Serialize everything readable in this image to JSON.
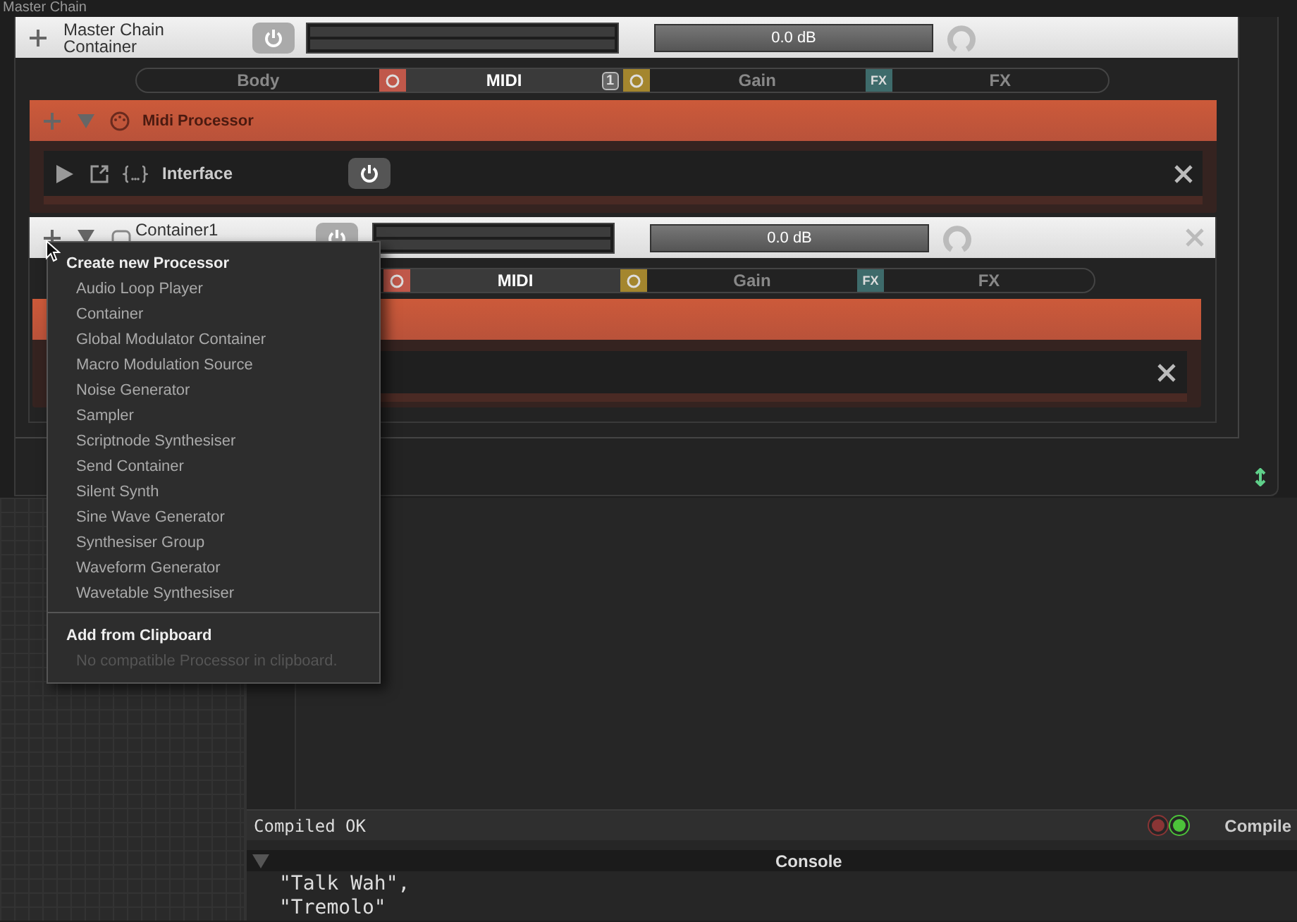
{
  "window": {
    "title": "Master Chain"
  },
  "master": {
    "name": "Master Chain",
    "type": "Container",
    "gain": "0.0 dB",
    "level": 1,
    "tabs": [
      {
        "label": "Body",
        "selected": false
      },
      {
        "label": "MIDI",
        "selected": true,
        "color": "#c0584a",
        "badge": "1"
      },
      {
        "label": "Gain",
        "selected": false,
        "color": "#a4862e"
      },
      {
        "label": "FX",
        "selected": false,
        "color": "#3e6b6b",
        "icon_text": "FX"
      }
    ],
    "children": [
      {
        "kind": "midi",
        "name": "Midi Processor",
        "row": {
          "name": "Interface"
        }
      },
      {
        "kind": "container",
        "name": "Container1",
        "gain": "0.0 dB",
        "level": 1,
        "tabs": [
          {
            "label": "MIDI",
            "selected": true,
            "color": "#c0584a"
          },
          {
            "label": "Gain",
            "selected": false,
            "color": "#a4862e"
          },
          {
            "label": "FX",
            "selected": false,
            "color": "#3e6b6b",
            "icon_text": "FX"
          }
        ]
      }
    ]
  },
  "context_menu": {
    "title": "Create new Processor",
    "items": [
      {
        "label": "Audio Loop Player",
        "disabled": false
      },
      {
        "label": "Container",
        "disabled": false
      },
      {
        "label": "Global Modulator Container",
        "disabled": false
      },
      {
        "label": "Macro Modulation Source",
        "disabled": false
      },
      {
        "label": "Noise Generator",
        "disabled": false
      },
      {
        "label": "Sampler",
        "disabled": false
      },
      {
        "label": "Scriptnode Synthesiser",
        "disabled": false
      },
      {
        "label": "Send Container",
        "disabled": false
      },
      {
        "label": "Silent Synth",
        "disabled": false
      },
      {
        "label": "Sine Wave Generator",
        "disabled": false
      },
      {
        "label": "Synthesiser Group",
        "disabled": false
      },
      {
        "label": "Waveform Generator",
        "disabled": false
      },
      {
        "label": "Wavetable Synthesiser",
        "disabled": false
      }
    ],
    "section": "Add from Clipboard",
    "section_items": [
      {
        "label": "No compatible Processor in clipboard.",
        "disabled": true
      }
    ]
  },
  "compile_bar": {
    "status": "Compiled OK",
    "indicators": [
      {
        "color": "#8a3535"
      },
      {
        "color": "#4cc23a"
      }
    ],
    "button": "Compile"
  },
  "console": {
    "title": "Console",
    "lines": [
      "\"Talk Wah\",",
      "\"Tremolo\""
    ]
  }
}
